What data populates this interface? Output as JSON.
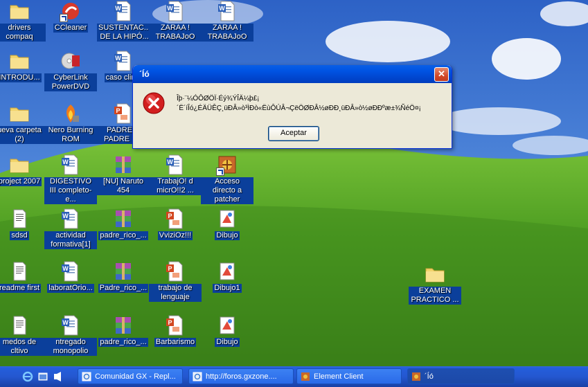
{
  "desktop": {
    "icons": [
      {
        "label": "drivers compaq",
        "type": "folder"
      },
      {
        "label": "CCleaner",
        "type": "ccleaner"
      },
      {
        "label": "SUSTENTAC... DE LA HIPÓ...",
        "type": "word"
      },
      {
        "label": "ZARAA ! TRABAJoO",
        "type": "word"
      },
      {
        "label": "ZARAA ! TRABAJoO",
        "type": "word"
      },
      {
        "label": "INTRODU...",
        "type": "folder"
      },
      {
        "label": "CyberLink PowerDVD",
        "type": "dvd"
      },
      {
        "label": "caso clinic",
        "type": "word"
      },
      {
        "label": "ueva carpeta (2)",
        "type": "folder"
      },
      {
        "label": "Nero Burning ROM",
        "type": "nero"
      },
      {
        "label": "PADRE R PADRE PO",
        "type": "ppt"
      },
      {
        "label": "project 2007",
        "type": "folder"
      },
      {
        "label": "DIGESTIVO III completo-e...",
        "type": "word"
      },
      {
        "label": "[NU] Naruto 454",
        "type": "rar"
      },
      {
        "label": "TrabajO! d micrO!!2 ...",
        "type": "word"
      },
      {
        "label": "Acceso directo a patcher",
        "type": "patcher"
      },
      {
        "label": "sdsd",
        "type": "text"
      },
      {
        "label": "actividad formativa[1]",
        "type": "word"
      },
      {
        "label": "padre_rico_...",
        "type": "rar"
      },
      {
        "label": "VviziOz!!!",
        "type": "ppt"
      },
      {
        "label": "Dibujo",
        "type": "paint"
      },
      {
        "label": "readme first",
        "type": "text"
      },
      {
        "label": "laboratOrio...",
        "type": "word"
      },
      {
        "label": "Padre_rico_...",
        "type": "rar"
      },
      {
        "label": "trabajo de lenguaje",
        "type": "ppt"
      },
      {
        "label": "Dibujo1",
        "type": "paint"
      },
      {
        "label": "EXAMEN PRACTICO ...",
        "type": "folder"
      },
      {
        "label": "medos de cltivo",
        "type": "text"
      },
      {
        "label": "ntregado monopolio",
        "type": "word"
      },
      {
        "label": "padre_rico_...",
        "type": "rar"
      },
      {
        "label": "Barbarismo",
        "type": "ppt"
      },
      {
        "label": "Dibujo",
        "type": "paint"
      }
    ]
  },
  "dialog": {
    "title": "´Íó",
    "message_line1": "Îþ·¨¼ÓÔØÖÏ·Éý¾ÝÎÄ¼þ£¡",
    "message_line2": "´Ë´íÎó¿ÉÄÜÊÇ¸üÐÂ»ò³ÌÐò«ËùÔÚÂ¬ÇëÖØÐÂ½øÐÐ¸üÐÂ»ò½øÐÐºæ±¾ÑéÖ¤¡",
    "ok_label": "Aceptar",
    "close_glyph": "✕"
  },
  "taskbar": {
    "buttons": [
      {
        "label": "Comunidad GX - Repl...",
        "icon": "ie-icon"
      },
      {
        "label": "http://foros.gxzone....",
        "icon": "ie-icon"
      },
      {
        "label": "Element Client",
        "icon": "game-icon"
      },
      {
        "label": "´Íó",
        "icon": "game-icon"
      }
    ]
  },
  "colors": {
    "sky": "#3a72c9",
    "grass": "#4f9a1f",
    "title_bar": "#0054e3",
    "label_bg": "#0b3f9b"
  }
}
